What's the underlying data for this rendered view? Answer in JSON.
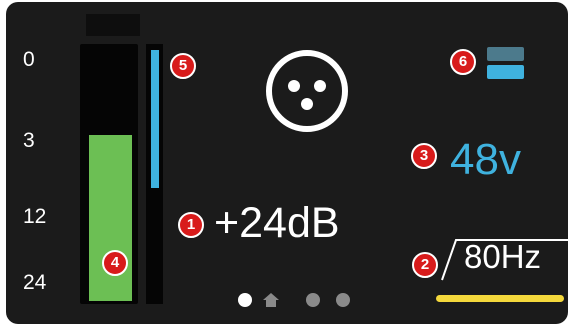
{
  "meter": {
    "scale_labels": [
      "0",
      "3",
      "12",
      "24"
    ],
    "main_level_fraction": 0.64,
    "side_level_fraction": 0.53,
    "colors": {
      "main_fill": "#6cbf54",
      "side_fill": "#3fb2df"
    }
  },
  "input": {
    "connector_icon": "xlr-connector-icon",
    "gain_text": "+24dB",
    "phantom_text": "48v",
    "hpf_text": "80Hz",
    "hpf_icon": "high-pass-filter-icon",
    "colors": {
      "phantom": "#3fb2df",
      "hpf_bar": "#f4d83c"
    }
  },
  "callouts": [
    "1",
    "2",
    "3",
    "4",
    "5",
    "6"
  ],
  "pager": {
    "current_page": 1,
    "icons": [
      "dot",
      "home-icon",
      "dot",
      "dot"
    ]
  }
}
